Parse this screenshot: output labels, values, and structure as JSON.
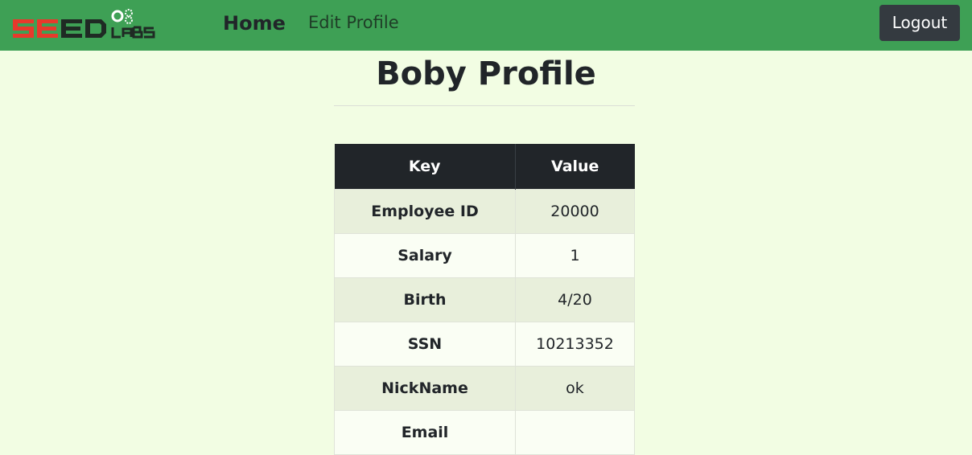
{
  "nav": {
    "logo_alt": "SEED LABS",
    "home": "Home",
    "edit_profile": "Edit Profile",
    "logout": "Logout"
  },
  "page": {
    "title": "Boby Profile"
  },
  "table": {
    "headers": [
      "Key",
      "Value"
    ],
    "rows": [
      {
        "key": "Employee ID",
        "value": "20000"
      },
      {
        "key": "Salary",
        "value": "1"
      },
      {
        "key": "Birth",
        "value": "4/20"
      },
      {
        "key": "SSN",
        "value": "10213352"
      },
      {
        "key": "NickName",
        "value": "ok"
      },
      {
        "key": "Email",
        "value": ""
      }
    ]
  },
  "colors": {
    "navbar": "#3ea055",
    "background": "#f2fde3",
    "header": "#212529",
    "logo_red": "#e8392c",
    "logo_dark": "#1f2a24"
  }
}
